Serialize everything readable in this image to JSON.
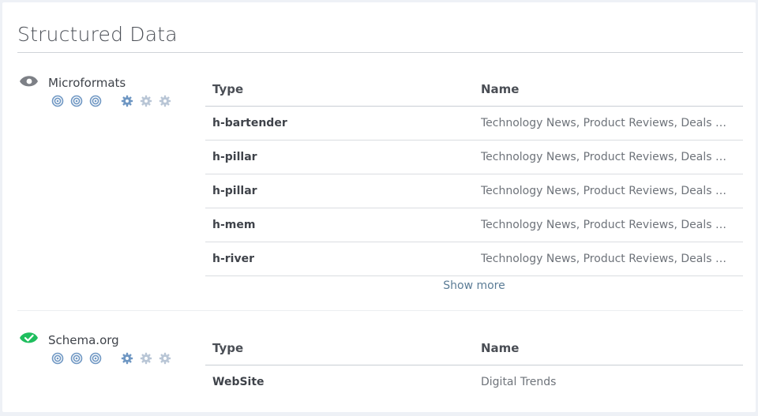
{
  "page": {
    "title": "Structured Data"
  },
  "colors": {
    "accent_blue": "#6f97c3",
    "success_green": "#1fbe5e",
    "neutral_gray": "#7d8086"
  },
  "sections": [
    {
      "title": "Microformats",
      "status_icon": "eye-icon",
      "table": {
        "headers": {
          "type": "Type",
          "name": "Name"
        },
        "rows": [
          {
            "type": "h-bartender",
            "name": "Technology News, Product Reviews, Deals & How-Tos"
          },
          {
            "type": "h-pillar",
            "name": "Technology News, Product Reviews, Deals & How-Tos"
          },
          {
            "type": "h-pillar",
            "name": "Technology News, Product Reviews, Deals & How-Tos"
          },
          {
            "type": "h-mem",
            "name": "Technology News, Product Reviews, Deals & How-Tos"
          },
          {
            "type": "h-river",
            "name": "Technology News, Product Reviews, Deals & How-Tos"
          }
        ],
        "show_more": "Show more"
      }
    },
    {
      "title": "Schema.org",
      "status_icon": "check-circle-icon",
      "table": {
        "headers": {
          "type": "Type",
          "name": "Name"
        },
        "rows": [
          {
            "type": "WebSite",
            "name": "Digital Trends"
          }
        ]
      }
    }
  ]
}
